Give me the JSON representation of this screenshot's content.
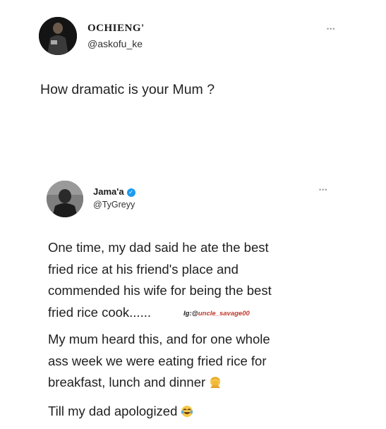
{
  "tweet1": {
    "name": "OCHIENG'",
    "handle": "@askofu_ke",
    "text": "How dramatic is your Mum ?",
    "menu_icon": "more-dots-icon"
  },
  "tweet2": {
    "name": "Jama'a",
    "handle": "@TyGreyy",
    "verified_icon": "verified-badge-icon",
    "menu_icon": "more-dots-icon",
    "para1_lines": [
      "One time, my dad said he ate the best",
      "fried rice at his friend's place and",
      "commended his wife for being the best",
      "fried rice cook......"
    ],
    "watermark_prefix": "Ig:@",
    "watermark_handle": "uncle_savage00",
    "para2_lines": [
      "My mum heard this, and for one whole",
      "ass week we were eating fried rice for",
      "breakfast, lunch and dinner"
    ],
    "para2_emoji": "person-facepalming-emoji",
    "para3": "Till my dad apologized",
    "para3_emoji": "face-with-tears-of-joy-emoji"
  }
}
